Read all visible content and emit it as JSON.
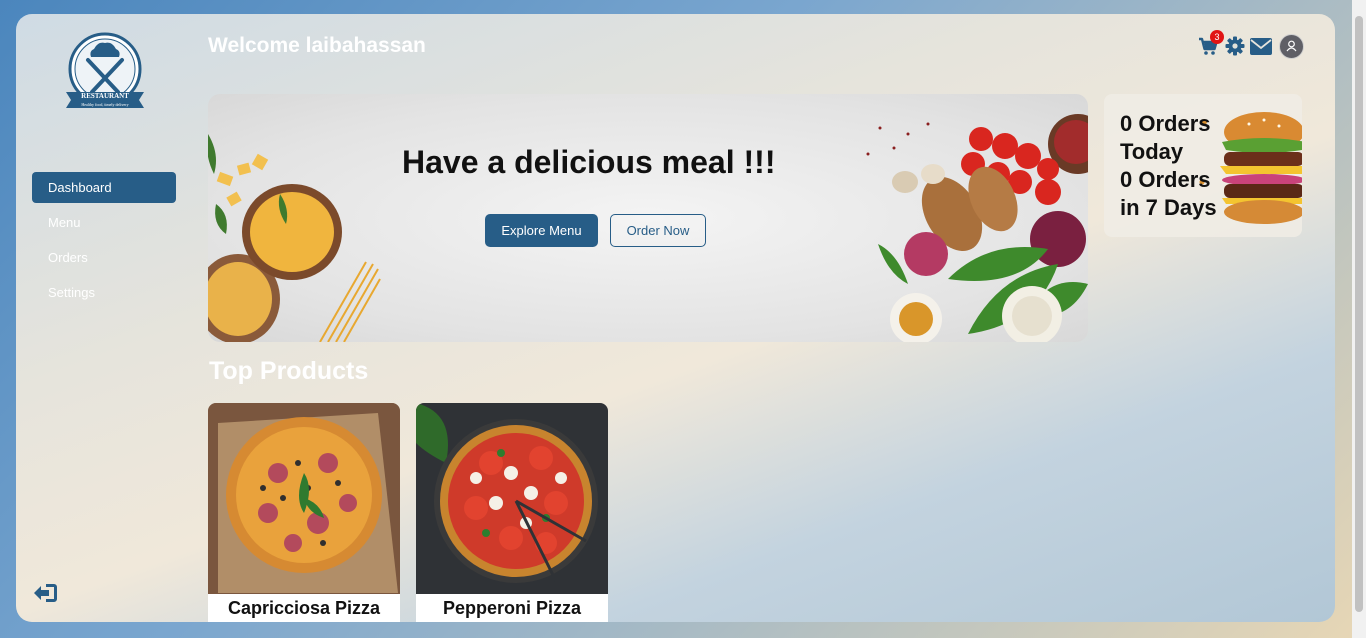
{
  "header": {
    "welcome": "Welcome laibahassan",
    "cart_count": "3",
    "icons": [
      "cart-icon",
      "gear-icon",
      "mail-icon",
      "user-avatar-icon"
    ]
  },
  "logo": {
    "brand": "RESTAURANT",
    "tagline": "Healthy food, timely delivery"
  },
  "sidebar": {
    "items": [
      {
        "label": "Dashboard",
        "active": true
      },
      {
        "label": "Menu",
        "active": false
      },
      {
        "label": "Orders",
        "active": false
      },
      {
        "label": "Settings",
        "active": false
      }
    ],
    "logout_icon": "logout-icon"
  },
  "banner": {
    "title": "Have a delicious meal !!!",
    "explore_label": "Explore Menu",
    "order_label": "Order Now"
  },
  "stats": {
    "lines": [
      "0 Orders",
      "Today",
      "0 Orders",
      "in 7 Days"
    ]
  },
  "top_products": {
    "title": "Top Products",
    "items": [
      {
        "name": "Capricciosa Pizza"
      },
      {
        "name": "Pepperoni Pizza"
      }
    ]
  },
  "colors": {
    "primary": "#275d87",
    "badge": "#e11414"
  }
}
